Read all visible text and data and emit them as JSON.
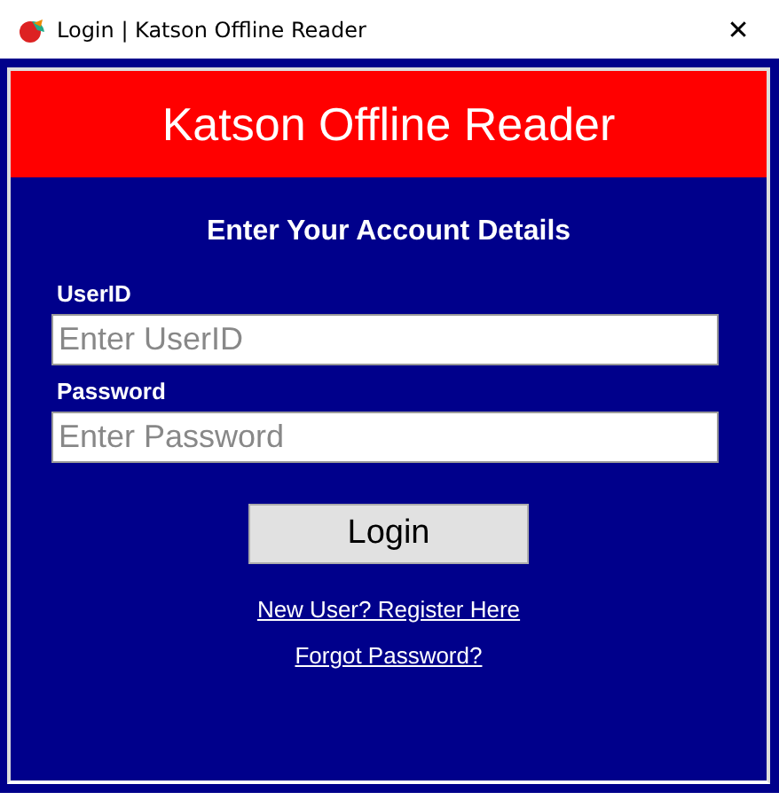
{
  "window": {
    "title": "Login | Katson Offline Reader",
    "close": "✕"
  },
  "header": {
    "title": "Katson Offline Reader"
  },
  "subtitle": "Enter Your Account Details",
  "fields": [
    {
      "label": "UserID",
      "placeholder": "Enter UserID"
    },
    {
      "label": "Password",
      "placeholder": "Enter Password"
    }
  ],
  "login_button": "Login",
  "links": [
    "New User? Register Here",
    "Forgot Password?"
  ]
}
